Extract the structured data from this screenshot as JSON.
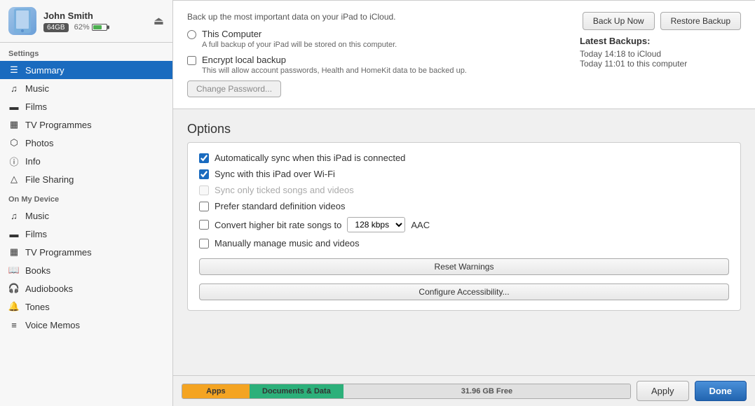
{
  "device": {
    "name": "John Smith",
    "storage_badge": "64GB",
    "battery_percent": "62%",
    "icon_alt": "iPad icon"
  },
  "sidebar": {
    "settings_label": "Settings",
    "on_device_label": "On My Device",
    "settings_items": [
      {
        "id": "summary",
        "label": "Summary",
        "icon": "☰",
        "active": true
      },
      {
        "id": "music",
        "label": "Music",
        "icon": "♪"
      },
      {
        "id": "films",
        "label": "Films",
        "icon": "🎬"
      },
      {
        "id": "tv",
        "label": "TV Programmes",
        "icon": "📺"
      },
      {
        "id": "photos",
        "label": "Photos",
        "icon": "📷"
      },
      {
        "id": "info",
        "label": "Info",
        "icon": "ℹ"
      },
      {
        "id": "filesharing",
        "label": "File Sharing",
        "icon": "🔗"
      }
    ],
    "device_items": [
      {
        "id": "music2",
        "label": "Music",
        "icon": "♪"
      },
      {
        "id": "films2",
        "label": "Films",
        "icon": "🎬"
      },
      {
        "id": "tv2",
        "label": "TV Programmes",
        "icon": "📺"
      },
      {
        "id": "books",
        "label": "Books",
        "icon": "📖"
      },
      {
        "id": "audiobooks",
        "label": "Audiobooks",
        "icon": "🎧"
      },
      {
        "id": "tones",
        "label": "Tones",
        "icon": "🔔"
      },
      {
        "id": "voicememos",
        "label": "Voice Memos",
        "icon": "🎵"
      }
    ]
  },
  "backup": {
    "top_text": "Back up the most important data on your iPad to iCloud.",
    "this_computer_label": "This Computer",
    "this_computer_sub": "A full backup of your iPad will be stored on this computer.",
    "encrypt_label": "Encrypt local backup",
    "encrypt_sub": "This will allow account passwords, Health and HomeKit data to be backed up.",
    "change_password_btn": "Change Password...",
    "back_up_now_btn": "Back Up Now",
    "restore_backup_btn": "Restore Backup",
    "latest_title": "Latest Backups:",
    "backup1": "Today 14:18 to iCloud",
    "backup2": "Today 11:01 to this computer"
  },
  "options": {
    "section_title": "Options",
    "auto_sync_label": "Automatically sync when this iPad is connected",
    "wifi_sync_label": "Sync with this iPad over Wi-Fi",
    "ticked_songs_label": "Sync only ticked songs and videos",
    "standard_def_label": "Prefer standard definition videos",
    "convert_songs_label": "Convert higher bit rate songs to",
    "bitrate_value": "128 kbps",
    "aac_label": "AAC",
    "manual_manage_label": "Manually manage music and videos",
    "reset_warnings_btn": "Reset Warnings",
    "configure_accessibility_btn": "Configure Accessibility..."
  },
  "storage_bar": {
    "apps_label": "Apps",
    "docs_label": "Documents & Data",
    "free_label": "31.96 GB Free"
  },
  "footer": {
    "apply_btn": "Apply",
    "done_btn": "Done"
  }
}
